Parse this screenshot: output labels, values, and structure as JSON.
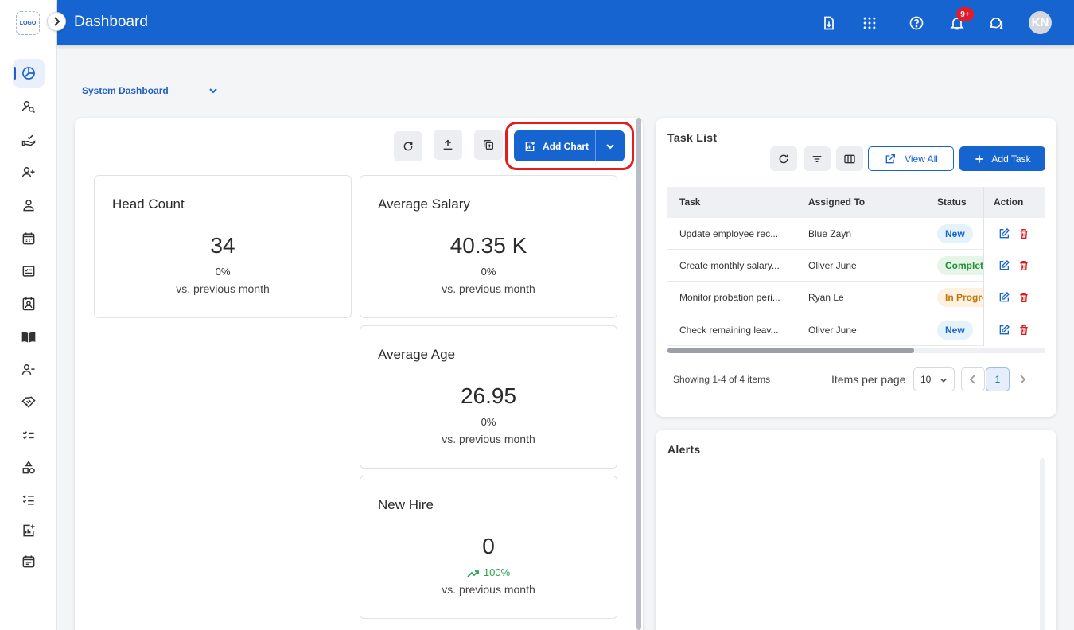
{
  "sidebar": {
    "logo_text": "LOGO",
    "items": [
      {
        "icon": "pie-chart-icon",
        "active": true
      },
      {
        "icon": "user-search-icon"
      },
      {
        "icon": "hand-check-icon"
      },
      {
        "icon": "user-add-icon"
      },
      {
        "icon": "user-icon"
      },
      {
        "icon": "calendar-icon"
      },
      {
        "icon": "checklist-form-icon"
      },
      {
        "icon": "contact-card-icon"
      },
      {
        "icon": "book-icon"
      },
      {
        "icon": "user-remove-icon"
      },
      {
        "icon": "handshake-icon"
      },
      {
        "icon": "task-list-icon"
      },
      {
        "icon": "shapes-icon"
      },
      {
        "icon": "ordered-list-icon"
      },
      {
        "icon": "chart-add-icon"
      },
      {
        "icon": "event-note-icon"
      }
    ]
  },
  "header": {
    "title": "Dashboard",
    "notification_count": "9+",
    "avatar_initials": "KN",
    "accent_color": "#1664d0"
  },
  "dashboard_select": {
    "value": "System Dashboard"
  },
  "toolbar": {
    "add_chart_label": "Add Chart"
  },
  "kpis": [
    {
      "title": "Head Count",
      "value": "34",
      "change": "0%",
      "compare": "vs. previous month"
    },
    {
      "title": "Average Salary",
      "value": "40.35 K",
      "change": "0%",
      "compare": "vs. previous month"
    },
    {
      "title": "Average Age",
      "value": "26.95",
      "change": "0%",
      "compare": "vs. previous month"
    },
    {
      "title": "New Hire",
      "value": "0",
      "change": "100%",
      "trend": "up",
      "compare": "vs. previous month"
    }
  ],
  "task_list": {
    "title": "Task List",
    "view_all_label": "View All",
    "add_task_label": "Add Task",
    "columns": [
      "Task",
      "Assigned To",
      "Status",
      "Action"
    ],
    "rows": [
      {
        "task": "Update employee rec...",
        "assigned_to": "Blue Zayn",
        "status": "New",
        "status_type": "new"
      },
      {
        "task": "Create monthly salary...",
        "assigned_to": "Oliver June",
        "status": "Completed",
        "status_type": "completed"
      },
      {
        "task": "Monitor probation peri...",
        "assigned_to": "Ryan Le",
        "status": "In Progress",
        "status_type": "progress"
      },
      {
        "task": "Check remaining leav...",
        "assigned_to": "Oliver June",
        "status": "New",
        "status_type": "new"
      }
    ],
    "showing": "Showing 1-4 of 4 items",
    "items_per_page_label": "Items per page",
    "items_per_page": "10",
    "current_page": "1"
  },
  "alerts": {
    "title": "Alerts"
  }
}
